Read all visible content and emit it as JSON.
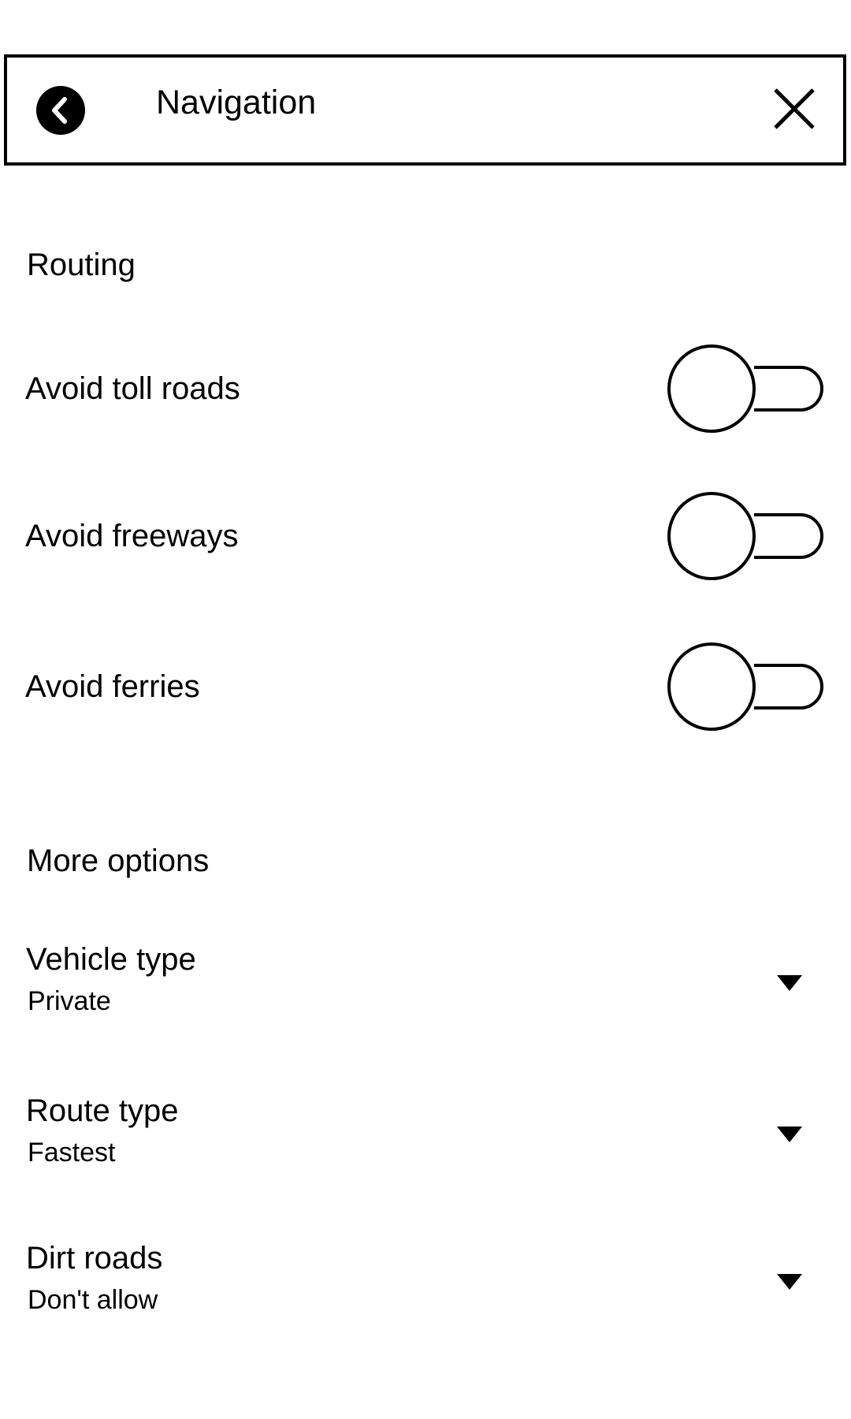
{
  "header": {
    "title": "Navigation",
    "back_icon": "chevron-left-circle-icon",
    "close_icon": "close-icon"
  },
  "routing": {
    "section_title": "Routing",
    "toggles": [
      {
        "label": "Avoid toll roads",
        "on": false
      },
      {
        "label": "Avoid freeways",
        "on": false
      },
      {
        "label": "Avoid ferries",
        "on": false
      }
    ]
  },
  "more_options": {
    "section_title": "More options",
    "dropdowns": [
      {
        "label": "Vehicle type",
        "value": "Private",
        "icon": "caret-down-icon"
      },
      {
        "label": "Route type",
        "value": "Fastest",
        "icon": "caret-down-icon"
      },
      {
        "label": "Dirt roads",
        "value": "Don't allow",
        "icon": "caret-down-icon"
      }
    ]
  },
  "colors": {
    "foreground": "#000000",
    "background": "#ffffff"
  }
}
